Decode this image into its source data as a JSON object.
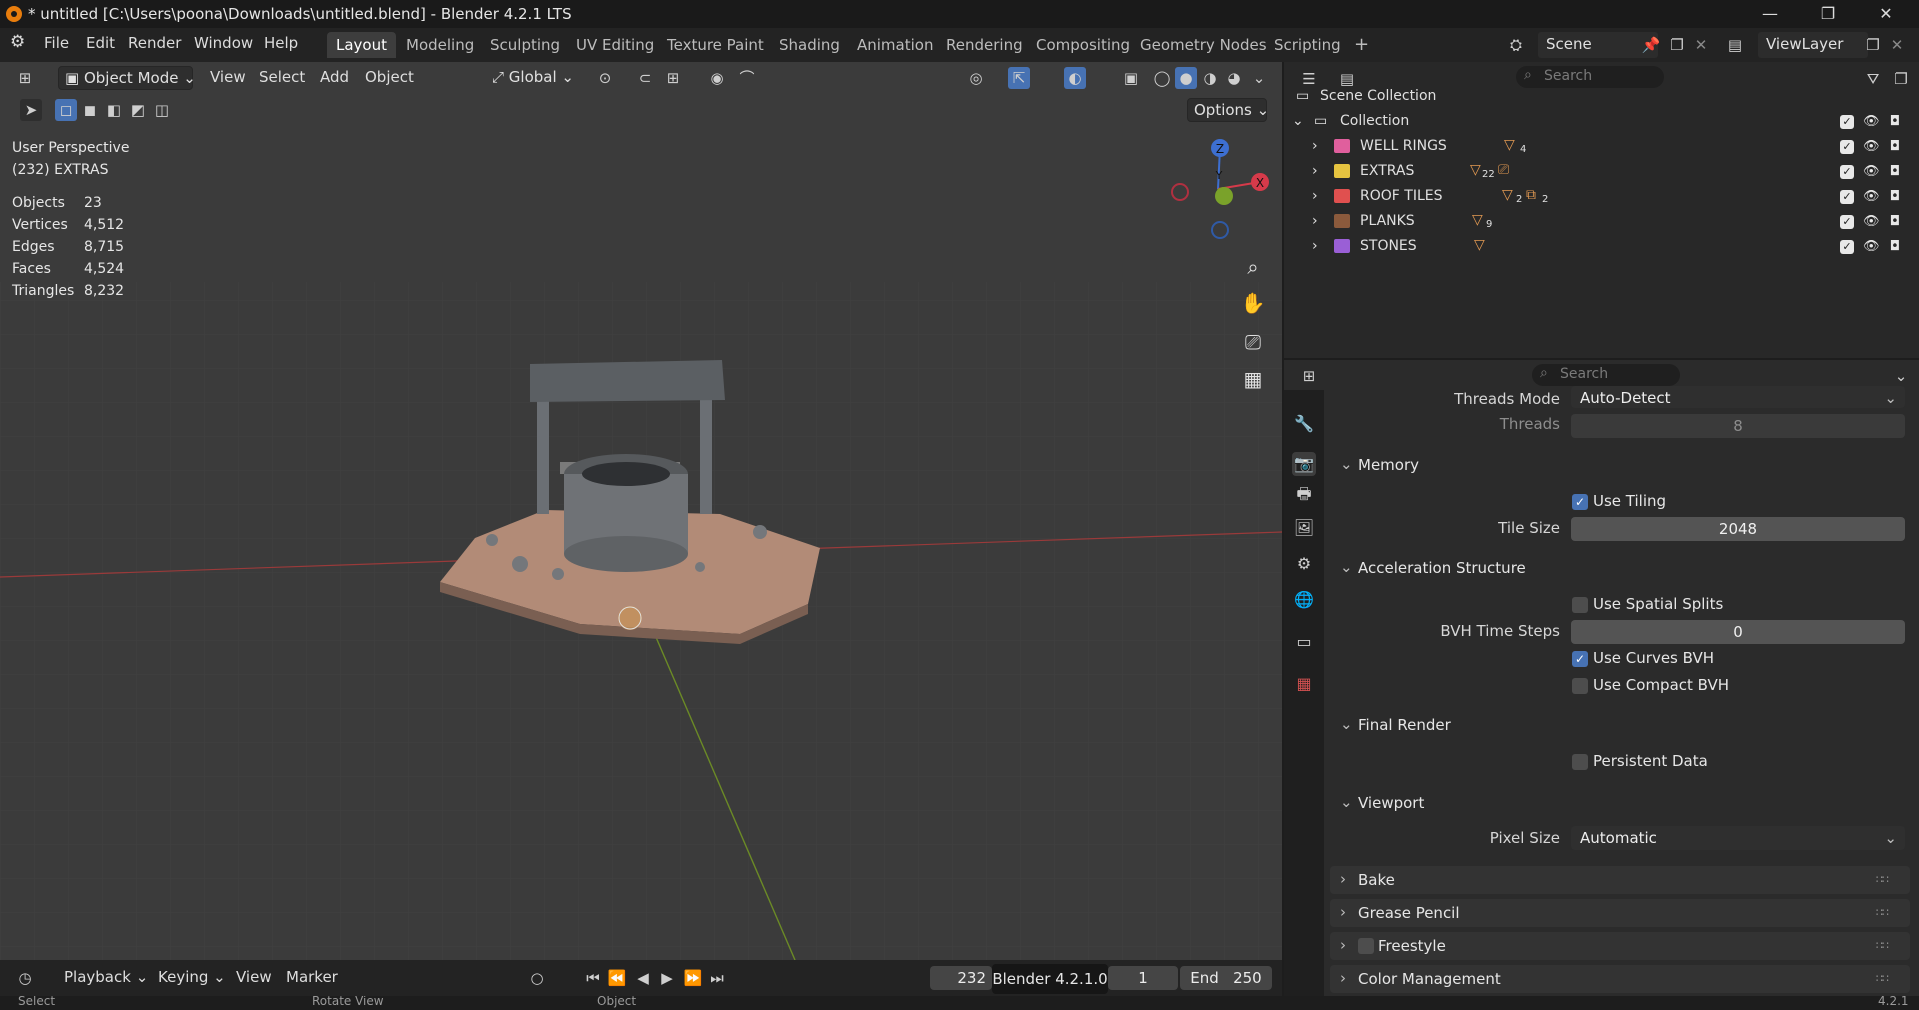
{
  "window": {
    "title": "* untitled [C:\\Users\\poona\\Downloads\\untitled.blend] - Blender 4.2.1 LTS",
    "minimize": "—",
    "maximize": "❐",
    "close": "✕"
  },
  "menubar": [
    "File",
    "Edit",
    "Render",
    "Window",
    "Help"
  ],
  "workspaces": [
    "Layout",
    "Modeling",
    "Sculpting",
    "UV Editing",
    "Texture Paint",
    "Shading",
    "Animation",
    "Rendering",
    "Compositing",
    "Geometry Nodes",
    "Scripting"
  ],
  "active_workspace": "Layout",
  "scene": {
    "name": "Scene",
    "view_layer": "ViewLayer"
  },
  "viewport_header": {
    "mode": "Object Mode",
    "menus": [
      "View",
      "Select",
      "Add",
      "Object"
    ],
    "transform_orientation": "Global",
    "options": "Options"
  },
  "viewport_info": {
    "view": "User Perspective",
    "collection": "(232) EXTRAS",
    "stats": [
      {
        "label": "Objects",
        "value": "23"
      },
      {
        "label": "Vertices",
        "value": "4,512"
      },
      {
        "label": "Edges",
        "value": "8,715"
      },
      {
        "label": "Faces",
        "value": "4,524"
      },
      {
        "label": "Triangles",
        "value": "8,232"
      }
    ]
  },
  "gizmo": {
    "z": "Z",
    "y": "Y",
    "x": "X"
  },
  "timeline": {
    "menus": [
      "Playback",
      "Keying",
      "View",
      "Marker"
    ],
    "current_frame": "232",
    "tooltip": "Blender 4.2.1.0",
    "start": "1",
    "end_label": "End",
    "end": "250"
  },
  "statusbar": {
    "select": "Select",
    "rotate": "Rotate View",
    "object": "Object",
    "version": "4.2.1"
  },
  "outliner": {
    "search_placeholder": "Search",
    "scene_collection": "Scene Collection",
    "collection": "Collection",
    "items": [
      {
        "name": "WELL RINGS",
        "badge": "4",
        "color": "#e05f9d"
      },
      {
        "name": "EXTRAS",
        "badge": "22",
        "color": "#e6c440"
      },
      {
        "name": "ROOF TILES",
        "badge": "2",
        "badge2": "2",
        "color": "#e0504f"
      },
      {
        "name": "PLANKS",
        "badge": "9",
        "color": "#8b5a3c"
      },
      {
        "name": "STONES",
        "badge": "",
        "color": "#9a5fd6"
      }
    ]
  },
  "properties": {
    "search_placeholder": "Search",
    "threads_mode_label": "Threads Mode",
    "threads_mode_value": "Auto-Detect",
    "threads_label": "Threads",
    "threads_value": "8",
    "memory": "Memory",
    "use_tiling": "Use Tiling",
    "tile_size_label": "Tile Size",
    "tile_size_value": "2048",
    "accel": "Acceleration Structure",
    "use_spatial_splits": "Use Spatial Splits",
    "bvh_time_steps_label": "BVH Time Steps",
    "bvh_time_steps_value": "0",
    "use_curves_bvh": "Use Curves BVH",
    "use_compact_bvh": "Use Compact BVH",
    "final_render": "Final Render",
    "persistent_data": "Persistent Data",
    "viewport": "Viewport",
    "pixel_size_label": "Pixel Size",
    "pixel_size_value": "Automatic",
    "bake": "Bake",
    "grease_pencil": "Grease Pencil",
    "freestyle": "Freestyle",
    "color_management": "Color Management"
  }
}
